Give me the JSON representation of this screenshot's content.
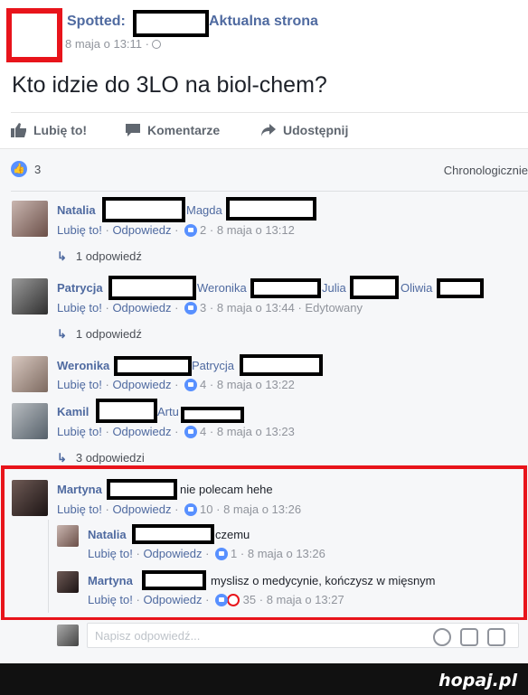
{
  "post": {
    "page_name": "Spotted:",
    "page_suffix": "Aktualna strona",
    "time": "8 maja o 13:11 ·",
    "text": "Kto idzie do 3LO na biol-chem?"
  },
  "actions": {
    "like": "Lubię to!",
    "comment": "Komentarze",
    "share": "Udostępnij"
  },
  "likes": {
    "count": "3",
    "sort": "Chronologicznie"
  },
  "comments": [
    {
      "name": "Natalia",
      "tags": [
        "Magda"
      ],
      "text": "",
      "like_label": "Lubię to!",
      "reply_label": "Odpowiedz",
      "likes": "2",
      "time": "· 8 maja o 13:12",
      "extra": "",
      "replies": "1 odpowiedź"
    },
    {
      "name": "Patrycja",
      "tags": [
        "Weronika",
        "Julia",
        "Oliwia"
      ],
      "text": "",
      "like_label": "Lubię to!",
      "reply_label": "Odpowiedz",
      "likes": "3",
      "time": "· 8 maja o 13:44",
      "extra": "· Edytowany",
      "replies": "1 odpowiedź"
    },
    {
      "name": "Weronika",
      "tags": [
        "Patrycja"
      ],
      "text": "",
      "like_label": "Lubię to!",
      "reply_label": "Odpowiedz",
      "likes": "4",
      "time": "· 8 maja o 13:22",
      "extra": "",
      "replies": ""
    },
    {
      "name": "Kamil",
      "tags": [
        "Artu"
      ],
      "text": "",
      "like_label": "Lubię to!",
      "reply_label": "Odpowiedz",
      "likes": "4",
      "time": "· 8 maja o 13:23",
      "extra": "",
      "replies": "3 odpowiedzi"
    },
    {
      "name": "Martyna",
      "tags": [],
      "text": "nie polecam hehe",
      "like_label": "Lubię to!",
      "reply_label": "Odpowiedz",
      "likes": "10",
      "time": "· 8 maja o 13:26",
      "extra": "",
      "replies": ""
    }
  ],
  "sub_replies": [
    {
      "name": "Natalia",
      "text": "czemu",
      "like_label": "Lubię to!",
      "reply_label": "Odpowiedz",
      "likes": "1",
      "time": "· 8 maja o 13:26"
    },
    {
      "name": "Martyna",
      "text": "myslisz o medycynie, kończysz w mięsnym",
      "like_label": "Lubię to!",
      "reply_label": "Odpowiedz",
      "likes": "35",
      "time": "· 8 maja o 13:27"
    }
  ],
  "write": {
    "placeholder": "Napisz odpowiedź..."
  },
  "footer": {
    "brand": "hopaj.pl"
  },
  "colors": {
    "link": "#4f6aa0",
    "like_blue": "#5890ff",
    "highlight_red": "#e8141b"
  }
}
